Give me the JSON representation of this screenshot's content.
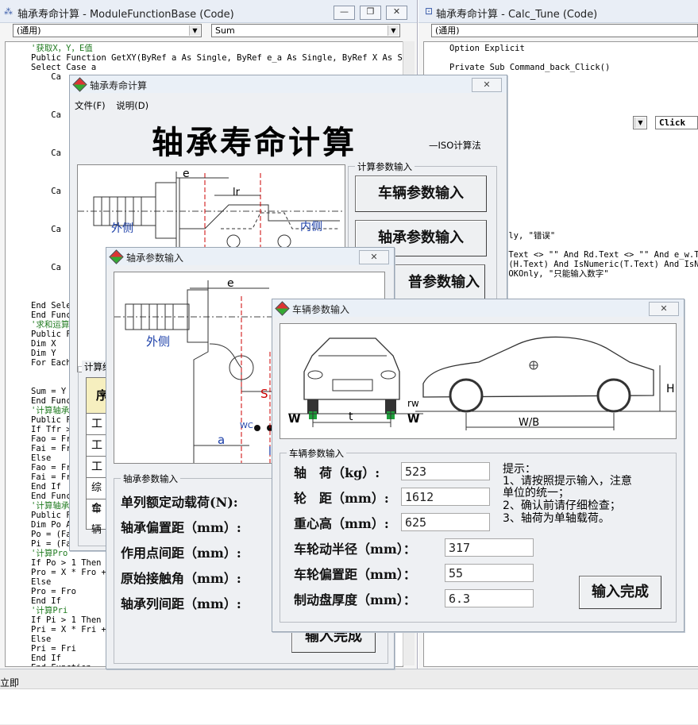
{
  "code_window_left": {
    "title": "轴承寿命计算 - ModuleFunctionBase (Code)",
    "object_combo": "(通用)",
    "proc_combo": "Sum",
    "buttons": [
      "—",
      "❐",
      "✕"
    ],
    "lines": [
      "'获取X，Y，E值",
      "Public Function GetXY(ByRef a As Single, ByRef e_a As Single, ByRef X As Sing",
      "Select Case a",
      "    Ca",
      "",
      "",
      "",
      "    Ca",
      "",
      "",
      "",
      "    Ca",
      "",
      "",
      "",
      "    Ca",
      "",
      "",
      "",
      "    Ca",
      "",
      "",
      "",
      "    Ca",
      "",
      "",
      "",
      "End Sele",
      "End Func",
      "'求和运算",
      "Public F",
      "Dim X",
      "Dim Y",
      "For Each",
      "",
      "        Ne",
      "Sum = Y",
      "End Func",
      "'计算轴承",
      "Public F",
      "If Tfr >",
      "Fao = Fr",
      "Fai = Fr",
      "Else",
      "Fao = Fr",
      "Fai = Fr",
      "End If",
      "End Func",
      "'计算轴承",
      "Public F",
      "Dim Po A",
      "Po = (Fa",
      "Pi = (Fa",
      "'计算Pro",
      "If Po > 1 Then",
      "Pro = X * Fro +",
      "Else",
      "Pro = Fro",
      "End If",
      "'计算Pri",
      "If Pi > 1 Then",
      "Pri = X * Fri +",
      "Else",
      "Pri = Fri",
      "End If",
      "End Function"
    ]
  },
  "code_window_right": {
    "title": "轴承寿命计算 - Calc_Tune (Code)",
    "object_combo": "(通用)",
    "proc_combo": "Click",
    "lines_top": [
      "Option Explicit",
      "",
      "Private Sub Command_back_Click()"
    ],
    "lines_bottom": [
      "nly, \"错误\"",
      "",
      ".Text <> \"\" And Rd.Text <> \"\" And e_w.Te",
      "c(H.Text) And IsNumeric(T.Text) And IsNu",
      "bOKOnly, \"只能输入数字\""
    ]
  },
  "immediate": {
    "label": "立即"
  },
  "main_form": {
    "title": "轴承寿命计算",
    "menu": [
      "文件(F)",
      "说明(D)"
    ],
    "heading": "轴承寿命计算",
    "subheading": "—ISO计算法",
    "group_label": "计算参数输入",
    "buttons": [
      "车辆参数输入",
      "轴承参数输入",
      "普参数输入"
    ],
    "diagram": {
      "e": "e",
      "lr": "lr",
      "outer": "外侧",
      "inner": "内侧"
    },
    "hidden_group_label": "计算结",
    "table_stub": [
      "工",
      "工",
      "工",
      "综合",
      "车辆"
    ],
    "table_header": "序"
  },
  "bearing_form": {
    "title": "轴承参数输入",
    "diagram": {
      "e": "e",
      "outer": "外侧",
      "s": "S",
      "wc": "WC",
      "a": "a",
      "l": "l"
    },
    "group_label": "轴承参数输入",
    "fields": [
      "单列额定动载荷(N):",
      "轴承偏置距（mm）:",
      "作用点间距（mm）:",
      "原始接触角（mm）:",
      "轴承列间距（mm）:"
    ],
    "submit": "输入完成"
  },
  "vehicle_form": {
    "title": "车辆参数输入",
    "diagram": {
      "rw": "rw",
      "w_left": "W",
      "w_right": "W",
      "t": "t",
      "h": "H",
      "wb": "W/B"
    },
    "group_label": "车辆参数输入",
    "fields": [
      {
        "label": "轴　荷（kg）:",
        "value": "523"
      },
      {
        "label": "轮　距（mm）:",
        "value": "1612"
      },
      {
        "label": "重心高（mm）:",
        "value": "625"
      },
      {
        "label": "车轮动半径（mm）：",
        "value": "317"
      },
      {
        "label": "车轮偏置距（mm）：",
        "value": "55"
      },
      {
        "label": "制动盘厚度（mm）：",
        "value": "6.3"
      }
    ],
    "hints": [
      "提示：",
      "1、请按照提示输入，注意",
      "单位的统一；",
      "2、确认前请仔细检查；",
      "3、轴荷为单轴载荷。"
    ],
    "submit": "输入完成"
  },
  "colors": {
    "accent_blue": "#1a3ea8",
    "title_bg": "#eaf0f7",
    "form_bg": "#eef0f3"
  }
}
